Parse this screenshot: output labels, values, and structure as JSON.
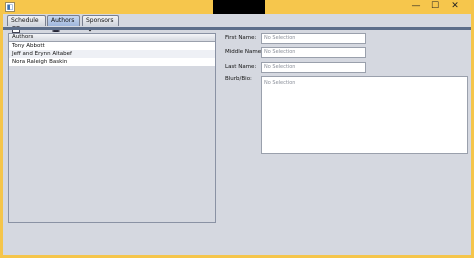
{
  "window": {
    "minimize_glyph": "—",
    "maximize_glyph": "☐",
    "close_glyph": "✕",
    "app_icon": "window-icon"
  },
  "tabs": [
    {
      "label": "Schedule",
      "icon": "calendar-icon"
    },
    {
      "label": "Authors",
      "icon": "hat-icon"
    },
    {
      "label": "Sponsors",
      "icon": "chevron-down-icon"
    }
  ],
  "authors": {
    "header": "Authors",
    "rows": [
      "Tony Abbott",
      "Jeff and Erynn Altabef",
      "Nora Raleigh Baskin"
    ]
  },
  "form": {
    "first_name": {
      "label": "First Name:",
      "value": "No Selection"
    },
    "middle_name": {
      "label": "Middle Name:",
      "value": "No Selection"
    },
    "last_name": {
      "label": "Last Name:",
      "value": "No Selection"
    },
    "bio": {
      "label": "Blurb/Bio:",
      "value": "No Selection"
    }
  },
  "colors": {
    "title_bar": "#f6c64c",
    "active_tab": "#9fb6dc",
    "background": "#d5d8e0"
  }
}
